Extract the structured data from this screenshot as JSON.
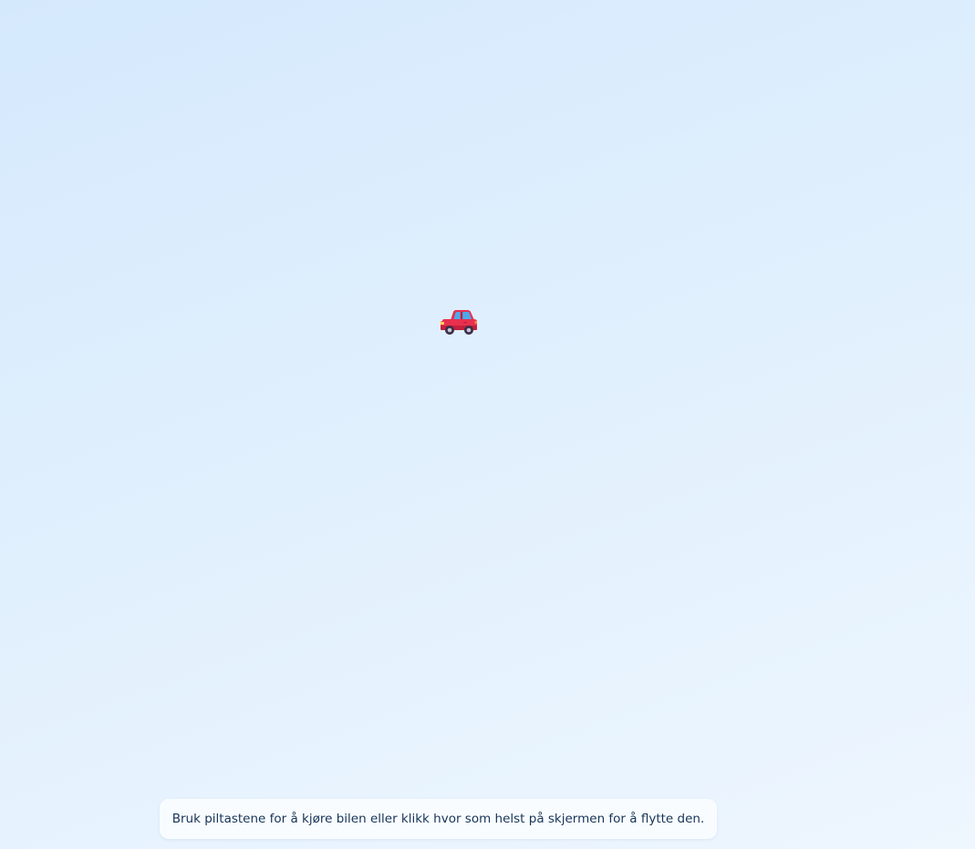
{
  "game": {
    "player": {
      "icon": "red-car-icon",
      "body_color": "#e8304f",
      "window_color": "#4fa8e8",
      "wheel_color": "#3b2f4a"
    },
    "hint": {
      "text": "Bruk piltastene for å kjøre bilen eller klikk hvor som helst på skjermen for å flytte den."
    },
    "colors": {
      "background_top": "#d5e9fd",
      "background_bottom": "#eef6fe",
      "hint_text": "#173457"
    }
  }
}
